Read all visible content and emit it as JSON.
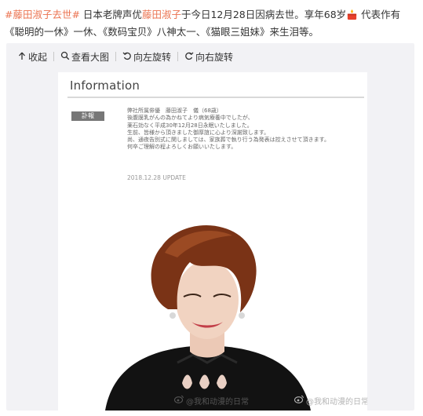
{
  "post": {
    "hashtag": "#藤田淑子去世#",
    "text_before_name": " 日本老牌声优",
    "name_link": "藤田淑子",
    "text_after_name": "于今日12月28日因病去世。享年68岁",
    "emoji": "candle-emoji",
    "text_line2": " 代表作有《聪明的一休》一休、《数码宝贝》八神太一、《猫眼三姐妹》来生泪等。"
  },
  "toolbar": {
    "collapse": "收起",
    "view_large": "查看大图",
    "rotate_left": "向左旋转",
    "rotate_right": "向右旋转"
  },
  "photo": {
    "info_title": "Information",
    "badge": "訃報",
    "lines": [
      "弊社所属俳優　藤田淑子　儀（68歳）",
      "後腹膜乳がんの為かねてより病気療養中でしたが、",
      "薬石効なく平成30年12月28日永眠いたしました。",
      "生前、皆様から頂きました御厚誼に心より深謝致します。",
      "尚、通夜告別式に関しましては、家族葬で執り行う為発表は控えさせて頂きます。",
      "何卒ご理解の程よろしくお願いいたします。"
    ],
    "update": "2018.12.28 UPDATE"
  },
  "watermarks": {
    "left": "@我和动漫的日常",
    "right": "@我和动漫的日常"
  },
  "colors": {
    "link": "#eb7350",
    "background_panel": "#f2f2f5"
  }
}
